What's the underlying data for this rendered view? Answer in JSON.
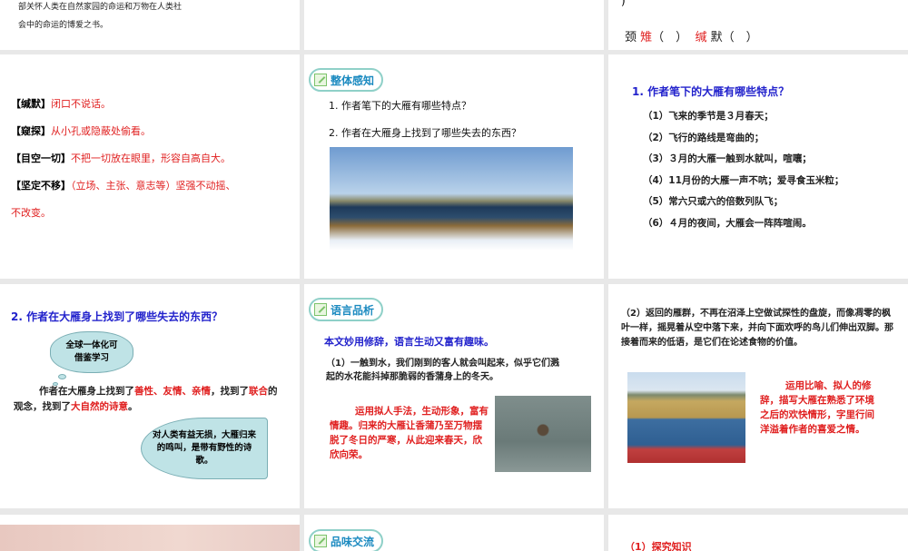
{
  "slides": {
    "s_top_left": {
      "line1": "部关怀人类在自然家园的命运和万物在人类社",
      "line2": "会中的命运的博爱之书。"
    },
    "s_top_right": {
      "paren": ")",
      "c1": "颈",
      "c2": "雉",
      "p1": "（　）",
      "c3": "缄",
      "c4": "默",
      "p2": "（　）"
    },
    "s_vocab": {
      "items": [
        {
          "term": "【缄默】",
          "def": "闭口不说话。"
        },
        {
          "term": "【窥探】",
          "def": "从小孔或隐蔽处偷看。"
        },
        {
          "term": "【目空一切】",
          "def": "不把一切放在眼里，形容自高自大。"
        },
        {
          "term": "【坚定不移】",
          "def": "（立场、主张、意志等）坚强不动摇、"
        }
      ],
      "cont": "不改变。"
    },
    "s_overview": {
      "badge": "整体感知",
      "q1": "1. 作者笔下的大雁有哪些特点？",
      "q2": "2. 作者在大雁身上找到了哪些失去的东西？"
    },
    "s_features": {
      "title": "1. 作者笔下的大雁有哪些特点？",
      "items": [
        "（1）飞来的季节是３月春天；",
        "（2）飞行的路线是弯曲的；",
        "（3）３月的大雁一触到水就叫，喧嚷；",
        "（4）11月份的大雁一声不吭；爱寻食玉米粒；",
        "（5）常六只或六的倍数列队飞；",
        "（6）４月的夜间，大雁会一阵阵喧闹。"
      ]
    },
    "s_lost": {
      "title": "2. 作者在大雁身上找到了哪些失去的东西？",
      "cloud": "全球一体化可借鉴学习",
      "p_a": "作者在大雁身上找到了",
      "r1": "善性、友情、亲情",
      "p_b": "，找到了",
      "r2": "联合",
      "p_c": "的观念，找到了",
      "r3": "大自然的诗意",
      "p_d": "。",
      "bubble": "对人类有益无损，大雁归来的鸣叫，是带有野性的诗歌。"
    },
    "s_lang": {
      "badge": "语言品析",
      "intro": "本文妙用修辞，语言生动又富有趣味。",
      "quote": "（1）一触到水，我们刚到的客人就会叫起来，似乎它们溅起的水花能抖掉那脆弱的香蒲身上的冬天。",
      "note": "运用拟人手法，生动形象，富有情趣。归来的大雁让香蒲乃至万物摆脱了冬日的严寒，从此迎来春天，欣欣向荣。"
    },
    "s_lang2": {
      "quote": "（2）返回的雁群，不再在沼泽上空做试探性的盘旋，而像凋零的枫叶一样，摇晃着从空中落下来，并向下面欢呼的鸟儿们伸出双脚。那接着而来的低语，是它们在论述食物的价值。",
      "note": "运用比喻、拟人的修辞，描写大雁在熟悉了环境之后的欢快情形，字里行间洋溢着作者的喜爱之情。"
    },
    "s_taste": {
      "badge": "品味交流"
    },
    "s_explore": {
      "text": "（1）探究知识"
    }
  }
}
